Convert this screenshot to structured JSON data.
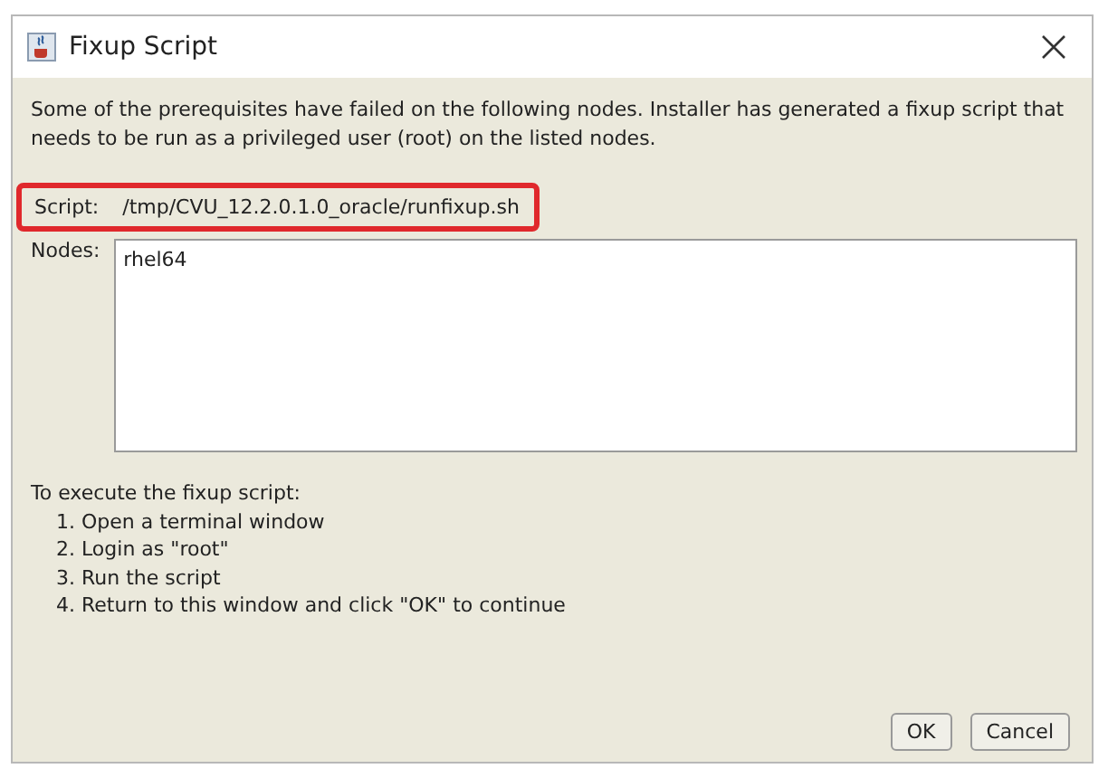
{
  "window": {
    "title": "Fixup Script"
  },
  "message": "Some of the prerequisites have failed on the following nodes. Installer has generated a fixup script that needs to be run as a privileged user (root) on the listed nodes.",
  "script": {
    "label": "Script:",
    "value": "/tmp/CVU_12.2.0.1.0_oracle/runfixup.sh",
    "highlighted": true
  },
  "nodes": {
    "label": "Nodes:",
    "value": "rhel64"
  },
  "instructions": {
    "heading": "To execute the fixup script:",
    "steps": [
      "1. Open a terminal window",
      "2. Login as \"root\"",
      "3. Run the script",
      "4. Return to this window and click \"OK\" to continue"
    ]
  },
  "buttons": [
    "OK",
    "Cancel"
  ]
}
